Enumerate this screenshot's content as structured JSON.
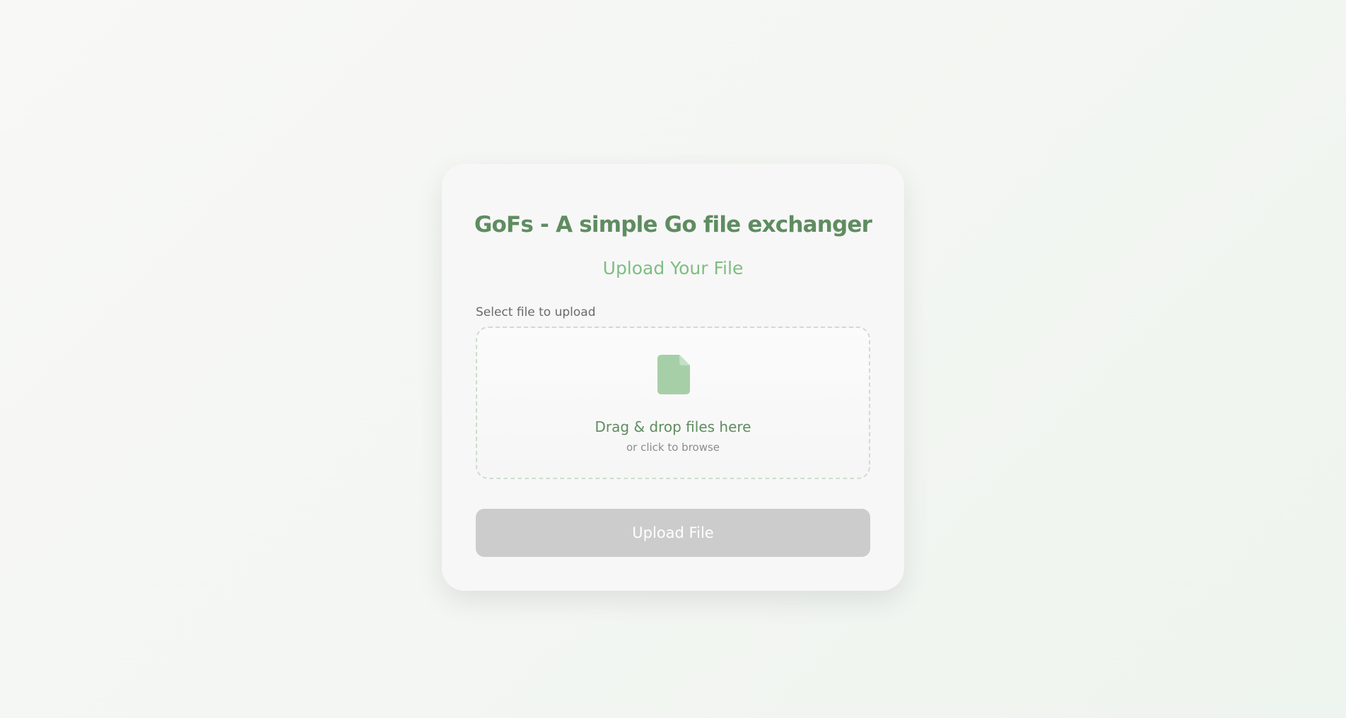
{
  "card": {
    "title": "GoFs - A simple Go file exchanger",
    "subtitle": "Upload Your File"
  },
  "form": {
    "field_label": "Select file to upload",
    "dropzone": {
      "icon": "file-icon",
      "title": "Drag & drop files here",
      "hint": "or click to browse"
    },
    "upload_button": {
      "label": "Upload File",
      "state": "disabled"
    }
  },
  "colors": {
    "accent": "#5f8c60",
    "accent_light": "#7fbd82",
    "icon_fill": "#a6cfa8",
    "button_disabled": "#cccccc"
  }
}
